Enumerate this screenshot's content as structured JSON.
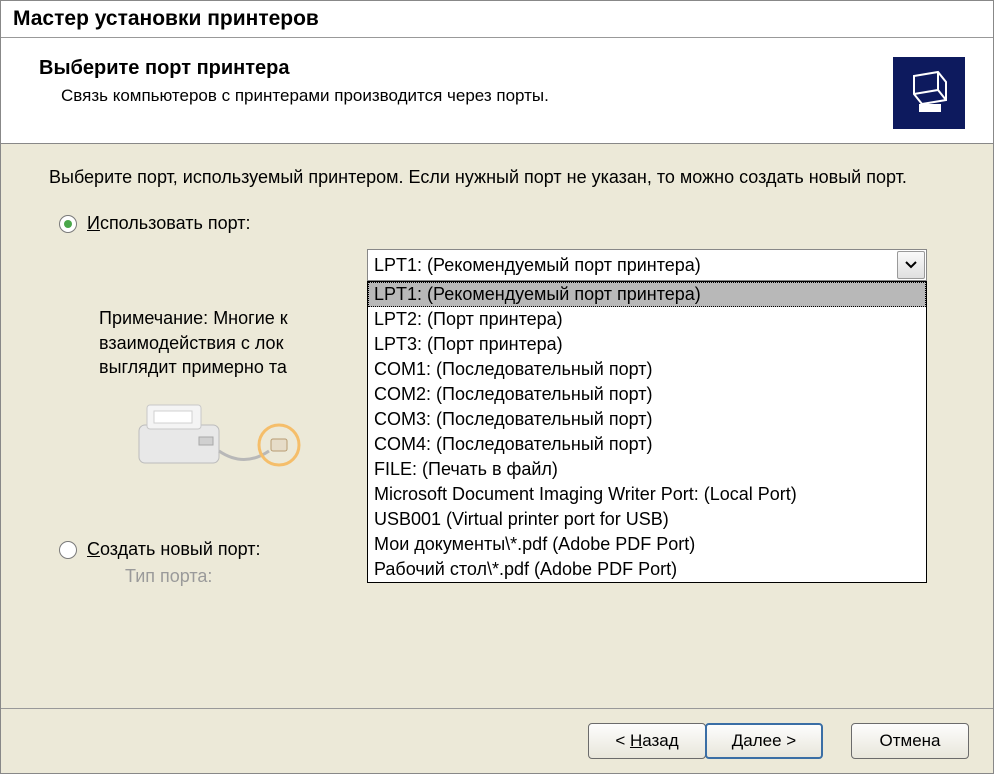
{
  "window": {
    "title": "Мастер установки принтеров"
  },
  "header": {
    "title": "Выберите порт принтера",
    "subtitle": "Связь компьютеров с принтерами производится через порты."
  },
  "content": {
    "instruction": "Выберите порт, используемый принтером. Если нужный порт не указан, то можно создать новый порт.",
    "use_port": {
      "prefix": "И",
      "rest": "спользовать порт:",
      "selected": "LPT1: (Рекомендуемый порт принтера)"
    },
    "dropdown_items": [
      "LPT1: (Рекомендуемый порт принтера)",
      "LPT2: (Порт принтера)",
      "LPT3: (Порт принтера)",
      "COM1: (Последовательный порт)",
      "COM2: (Последовательный порт)",
      "COM3: (Последовательный порт)",
      "COM4: (Последовательный порт)",
      "FILE: (Печать в файл)",
      "Microsoft Document Imaging Writer Port: (Local Port)",
      "USB001 (Virtual printer port for USB)",
      "Мои документы\\*.pdf (Adobe PDF Port)",
      "Рабочий стол\\*.pdf (Adobe PDF Port)"
    ],
    "note_line1": "Примечание: Многие к",
    "note_line2": "взаимодействия с лок",
    "note_line3": "выглядит примерно та",
    "create_port": {
      "prefix": "С",
      "rest": "оздать новый порт:"
    },
    "port_type_label": "Тип порта:"
  },
  "footer": {
    "back_prefix": "< ",
    "back_u": "Н",
    "back_rest": "азад",
    "next_prefix": "",
    "next_u": "Д",
    "next_rest": "алее >",
    "cancel": "Отмена"
  }
}
